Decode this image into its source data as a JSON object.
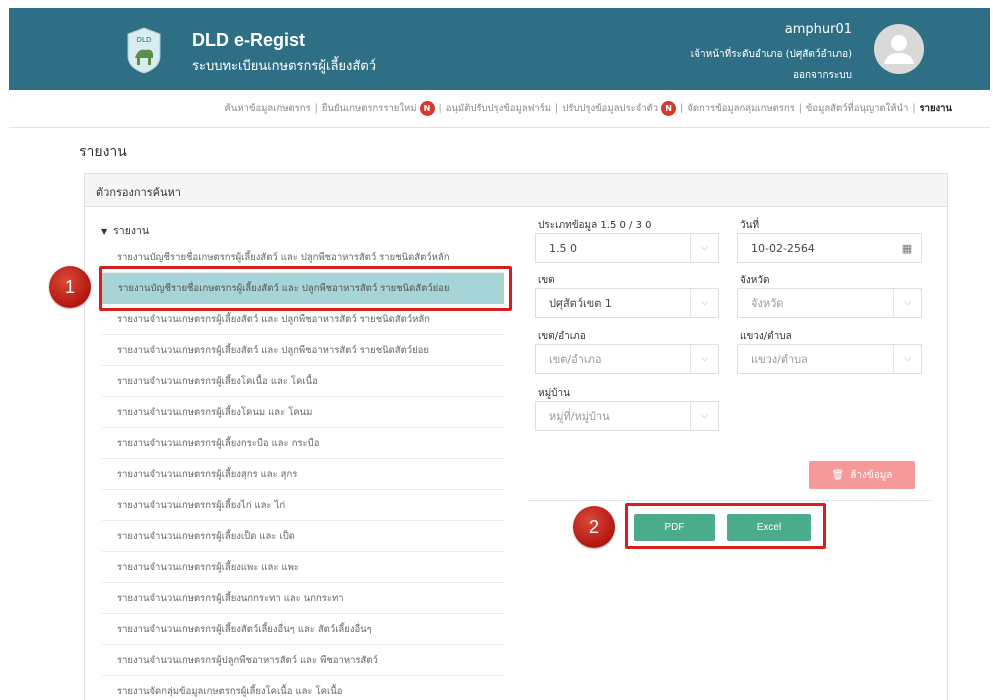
{
  "header": {
    "app_title": "DLD e-Regist",
    "app_subtitle": "ระบบทะเบียนเกษตรกรผู้เลี้ยงสัตว์",
    "user_name": "amphur01",
    "user_role": "เจ้าหน้าที่ระดับอำเภอ (ปศุสัตว์อำเภอ)",
    "logout_label": "ออกจากระบบ",
    "logo_text": "DLD"
  },
  "nav": {
    "items": [
      {
        "label": "ค้นหาข้อมูลเกษตรกร"
      },
      {
        "label": "ยืนยันเกษตรกรรายใหม่",
        "badge": "N"
      },
      {
        "label": "อนุมัติปรับปรุงข้อมูลฟาร์ม"
      },
      {
        "label": "ปรับปรุงข้อมูลประจำตัว",
        "badge": "N"
      },
      {
        "label": "จัดการข้อมูลกลุ่มเกษตรกร"
      },
      {
        "label": "ข้อมูลสัตว์ที่อนุญาตให้นำ"
      },
      {
        "label": "รายงาน"
      }
    ]
  },
  "page": {
    "title": "รายงาน",
    "panel_title": "ตัวกรองการค้นหา",
    "tree_root": "รายงาน"
  },
  "reports": [
    "รายงานบัญชีรายชื่อเกษตรกรผู้เลี้ยงสัตว์ และ ปลูกพืชอาหารสัตว์ รายชนิดสัตว์หลัก",
    "รายงานบัญชีรายชื่อเกษตรกรผู้เลี้ยงสัตว์ และ ปลูกพืชอาหารสัตว์ รายชนิดสัตว์ย่อย",
    "รายงานจำนวนเกษตรกรผู้เลี้ยงสัตว์ และ ปลูกพืชอาหารสัตว์ รายชนิดสัตว์หลัก",
    "รายงานจำนวนเกษตรกรผู้เลี้ยงสัตว์ และ ปลูกพืชอาหารสัตว์ รายชนิดสัตว์ย่อย",
    "รายงานจำนวนเกษตรกรผู้เลี้ยงโคเนื้อ และ โคเนื้อ",
    "รายงานจำนวนเกษตรกรผู้เลี้ยงโคนม และ โคนม",
    "รายงานจำนวนเกษตรกรผู้เลี้ยงกระบือ และ กระบือ",
    "รายงานจำนวนเกษตรกรผู้เลี้ยงสุกร และ สุกร",
    "รายงานจำนวนเกษตรกรผู้เลี้ยงไก่ และ ไก่",
    "รายงานจำนวนเกษตรกรผู้เลี้ยงเป็ด และ เป็ด",
    "รายงานจำนวนเกษตรกรผู้เลี้ยงแพะ และ แพะ",
    "รายงานจำนวนเกษตรกรผู้เลี้ยงนกกระทา และ นกกระทา",
    "รายงานจำนวนเกษตรกรผู้เลี้ยงสัตว์เลี้ยงอื่นๆ และ สัตว์เลี้ยงอื่นๆ",
    "รายงานจำนวนเกษตรกรผู้ปลูกพืชอาหารสัตว์ และ พืชอาหารสัตว์",
    "รายงานจัดกลุ่มข้อมูลเกษตรกรผู้เลี้ยงโคเนื้อ และ โคเนื้อ"
  ],
  "form": {
    "data_type_label": "ประเภทข้อมูล 1.5 0 / 3 0",
    "data_type_value": "1.5 0",
    "date_label": "วันที่",
    "date_value": "10-02-2564",
    "zone_label": "เขต",
    "zone_value": "ปศุสัตว์เขต 1",
    "province_label": "จังหวัด",
    "province_placeholder": "จังหวัด",
    "district_label": "เขต/อำเภอ",
    "district_placeholder": "เขต/อำเภอ",
    "subdistrict_label": "แขวง/ตำบล",
    "subdistrict_placeholder": "แขวง/ตำบล",
    "village_label": "หมู่บ้าน",
    "village_placeholder": "หมู่ที่/หมู่บ้าน",
    "clear_label": "ล้างข้อมูล",
    "pdf_label": "PDF",
    "excel_label": "Excel"
  },
  "annotations": {
    "step1": "1",
    "step2": "2"
  },
  "colors": {
    "header": "#2f6f85",
    "selected": "#a6d4d7",
    "green": "#4bab8a",
    "highlight": "#d61f1f"
  }
}
